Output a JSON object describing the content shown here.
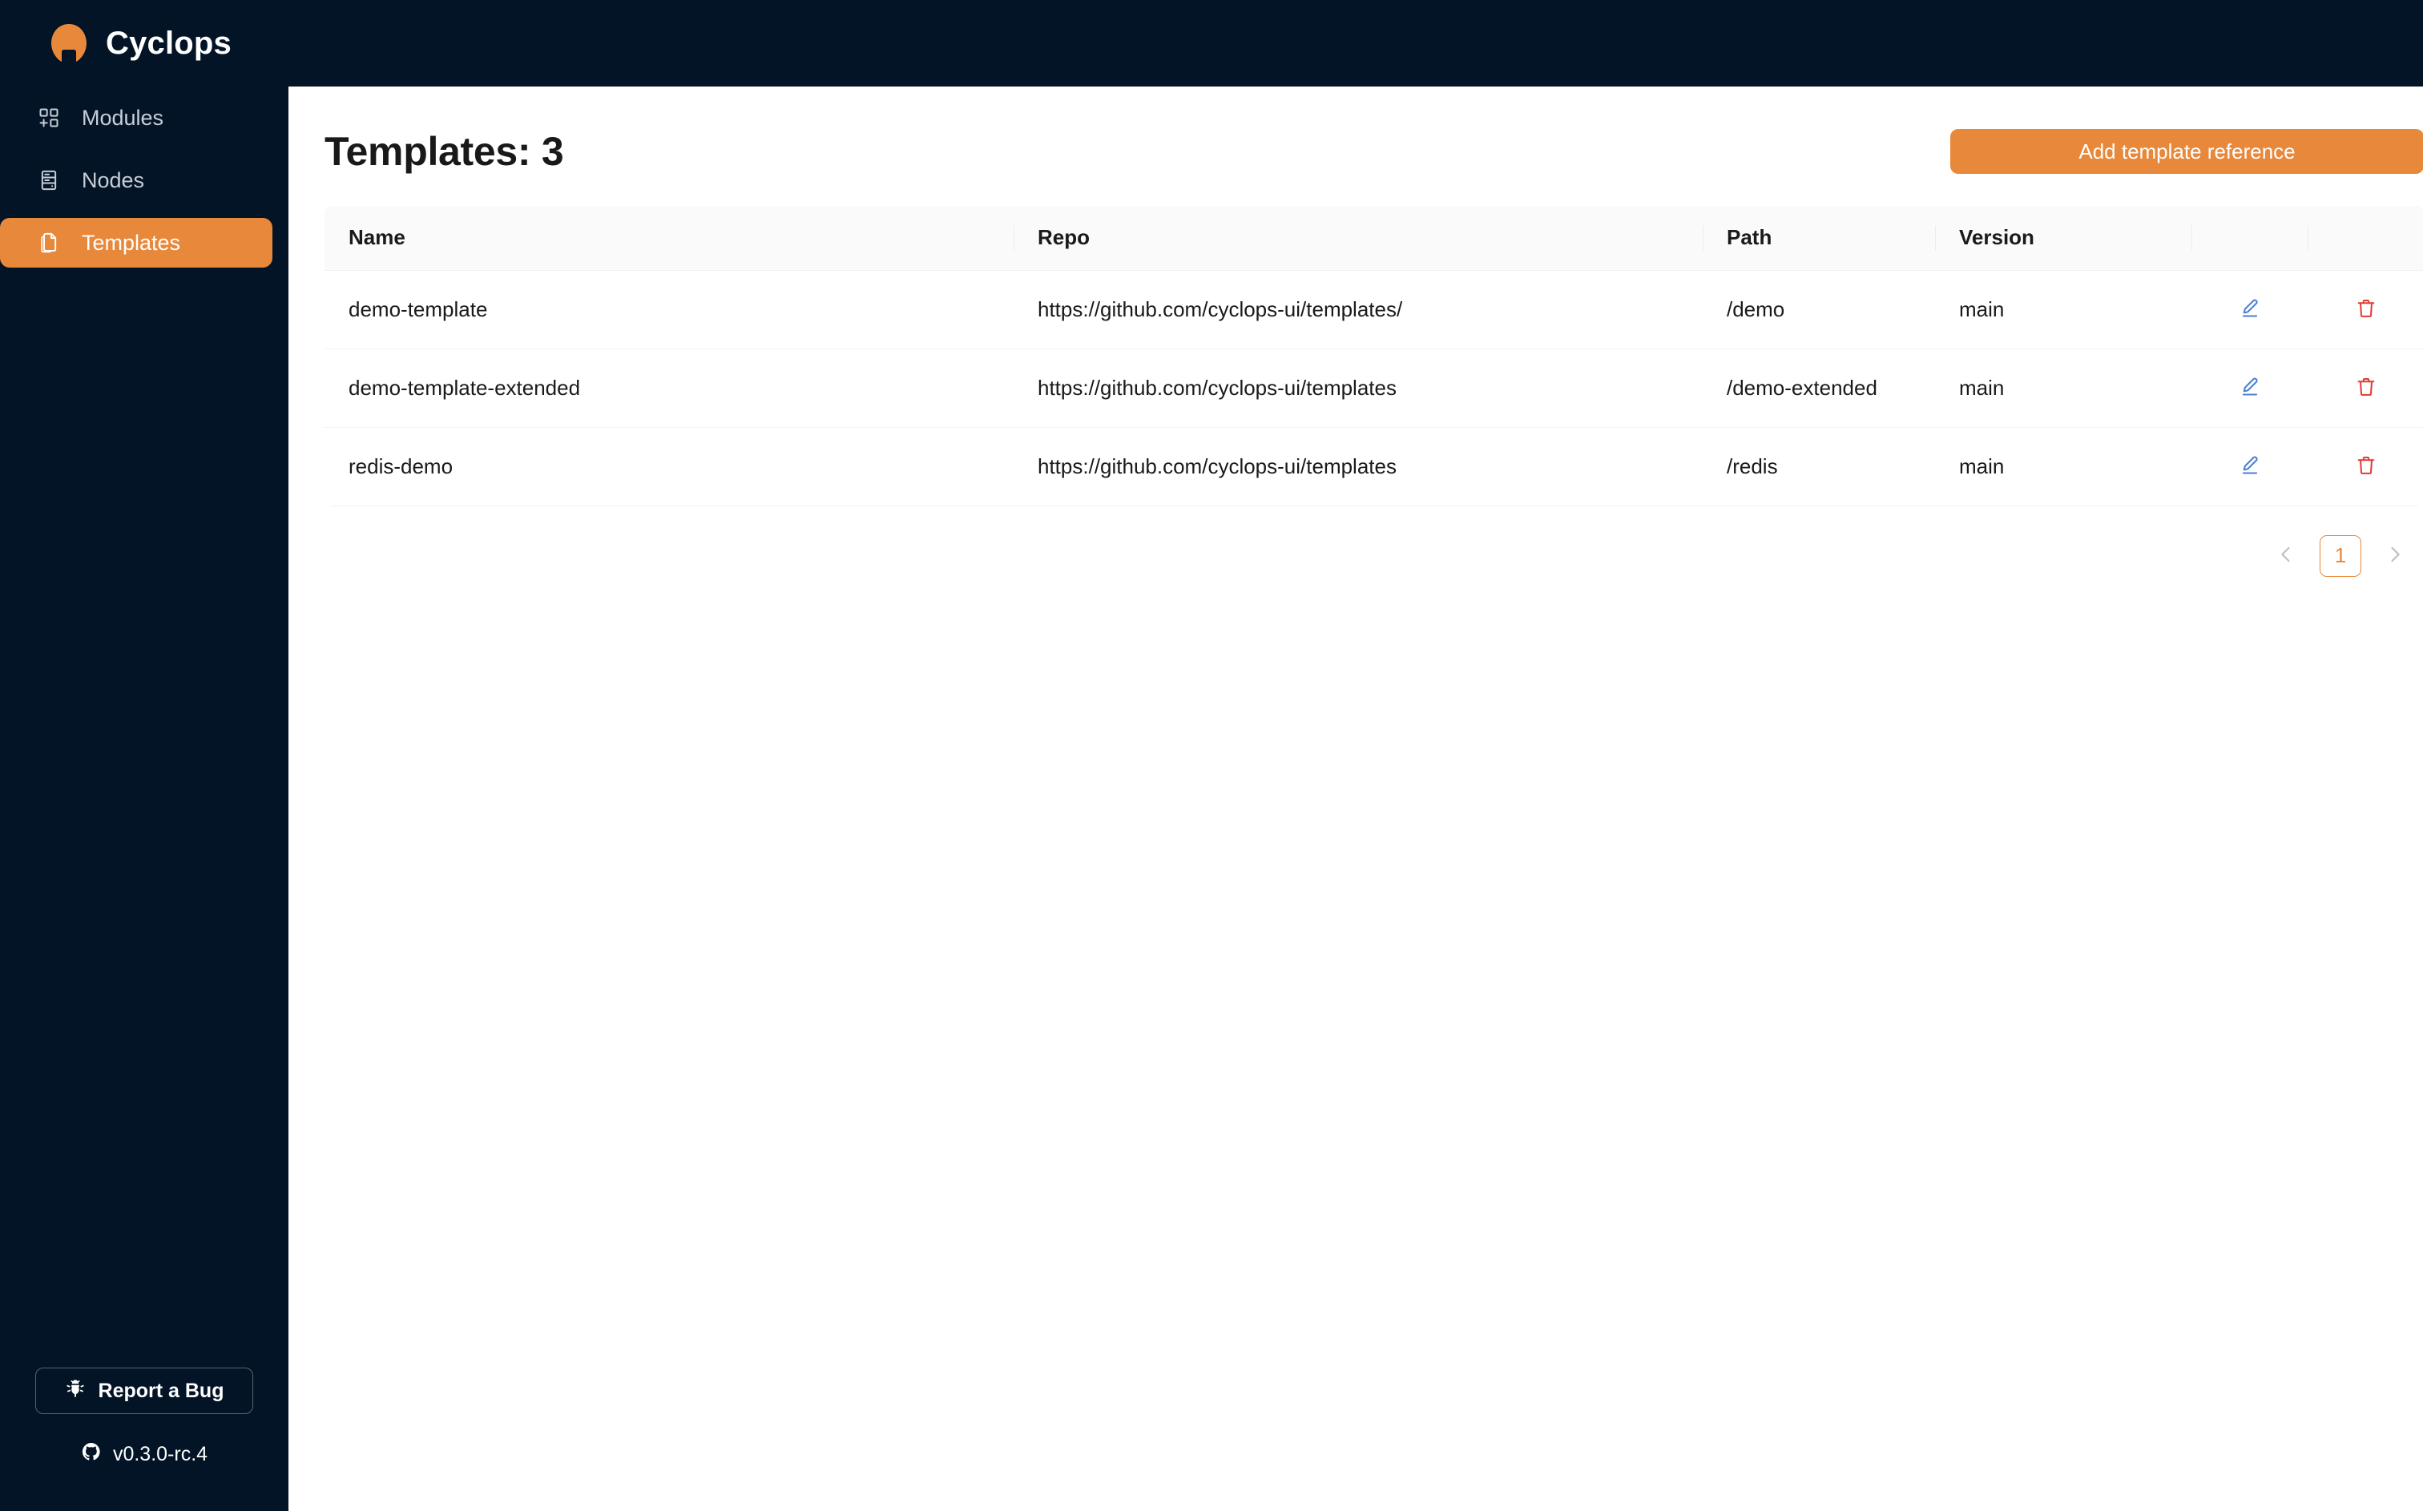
{
  "brand": {
    "name": "Cyclops",
    "logo_icon": "cyclops-logo-icon"
  },
  "sidebar": {
    "items": [
      {
        "label": "Modules",
        "icon": "appstore-add-icon",
        "active": false
      },
      {
        "label": "Nodes",
        "icon": "server-rack-icon",
        "active": false
      },
      {
        "label": "Templates",
        "icon": "file-copy-icon",
        "active": true
      }
    ],
    "footer": {
      "report_bug_label": "Report a Bug",
      "report_bug_icon": "bug-icon",
      "version": "v0.3.0-rc.4",
      "version_icon": "github-icon"
    }
  },
  "main": {
    "page_title": "Templates: 3",
    "add_button_label": "Add template reference",
    "table": {
      "columns": [
        "Name",
        "Repo",
        "Path",
        "Version",
        "",
        ""
      ],
      "rows": [
        {
          "name": "demo-template",
          "repo": "https://github.com/cyclops-ui/templates/",
          "path": "/demo",
          "version": "main",
          "edit_icon": "edit-pencil-icon",
          "delete_icon": "trash-icon"
        },
        {
          "name": "demo-template-extended",
          "repo": "https://github.com/cyclops-ui/templates",
          "path": "/demo-extended",
          "version": "main",
          "edit_icon": "edit-pencil-icon",
          "delete_icon": "trash-icon"
        },
        {
          "name": "redis-demo",
          "repo": "https://github.com/cyclops-ui/templates",
          "path": "/redis",
          "version": "main",
          "edit_icon": "edit-pencil-icon",
          "delete_icon": "trash-icon"
        }
      ]
    },
    "pagination": {
      "prev_icon": "chevron-left-icon",
      "next_icon": "chevron-right-icon",
      "current_page": "1"
    }
  },
  "colors": {
    "sidebar_bg": "#031426",
    "accent_orange": "#E8883A",
    "edit_blue": "#4a7fd4",
    "delete_red": "#e03a32",
    "table_header_bg": "#FAFAFA",
    "page_bg": "#FFFFFF"
  }
}
